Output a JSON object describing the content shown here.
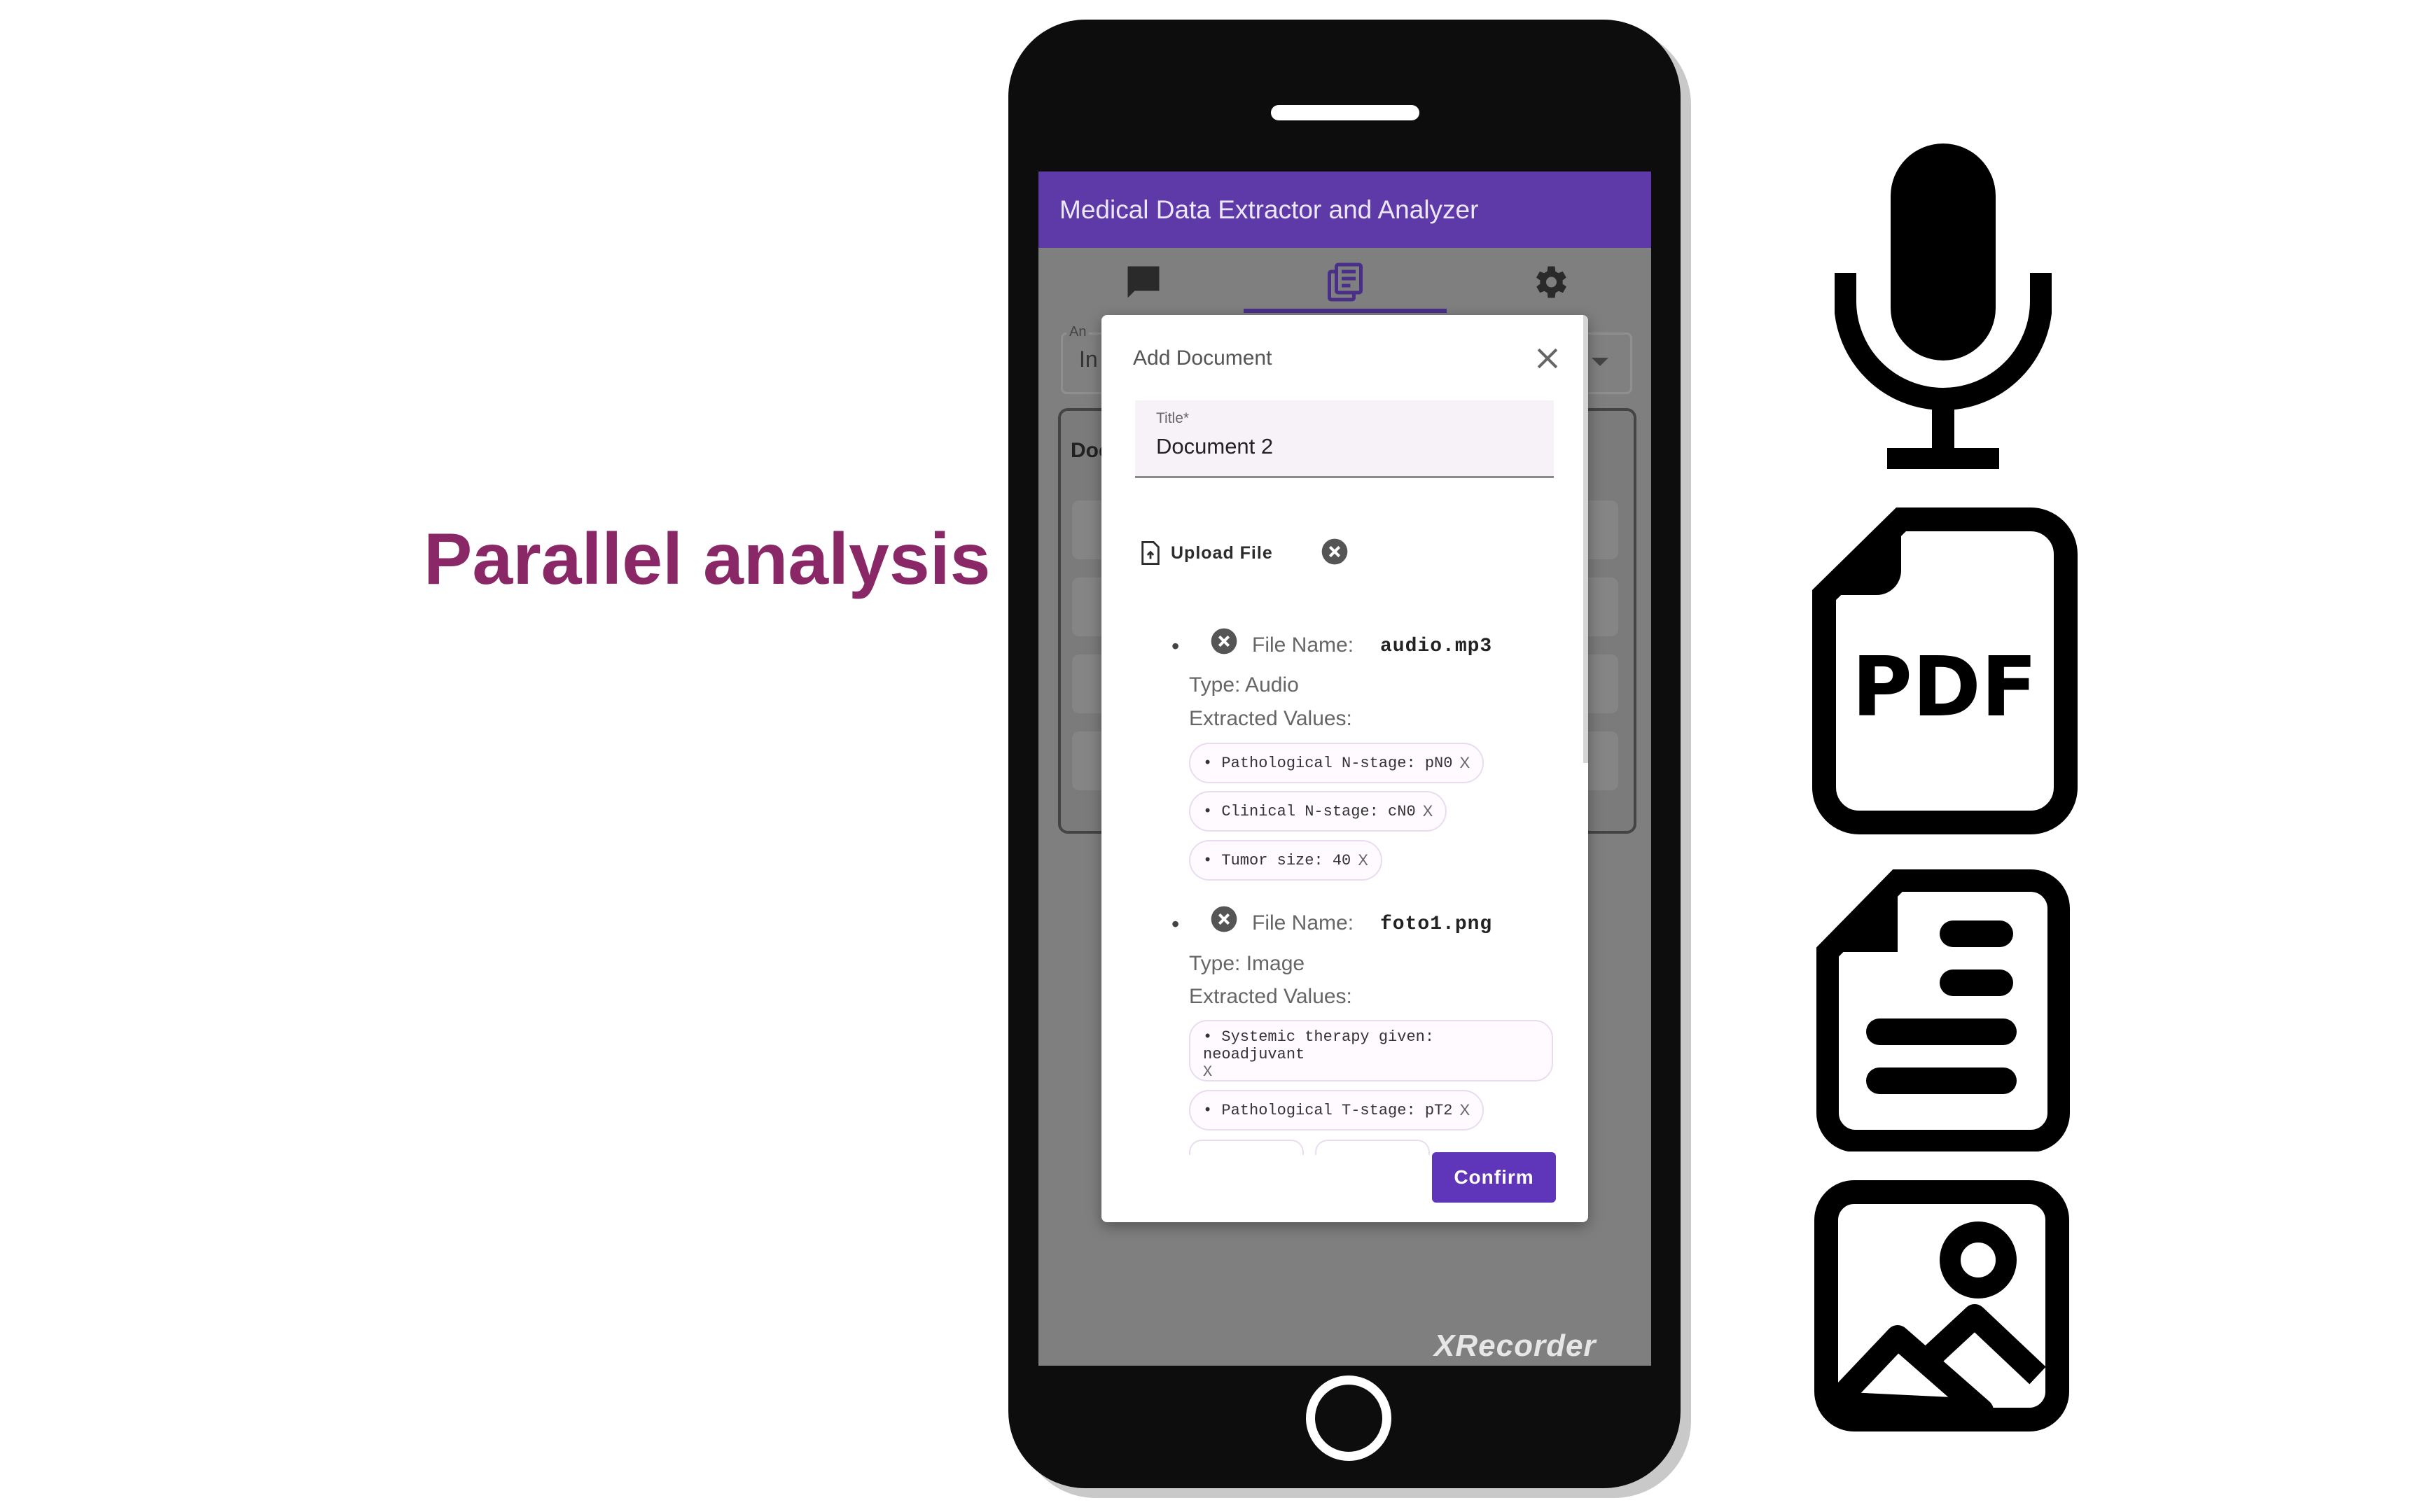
{
  "headline": "Parallel analysis",
  "app": {
    "title": "Medical Data Extractor and Analyzer",
    "tabs": [
      {
        "icon": "chat-icon"
      },
      {
        "icon": "document-list-icon",
        "selected": true
      },
      {
        "icon": "gear-icon"
      }
    ],
    "background": {
      "select_label": "An",
      "select_value": "In",
      "card_title": "Doc"
    }
  },
  "dialog": {
    "title": "Add Document",
    "title_field": {
      "label": "Title*",
      "value": "Document 2"
    },
    "upload_label": "Upload File",
    "file_name_label": "File Name:",
    "extracted_values_label": "Extracted Values:",
    "files": [
      {
        "name": "audio.mp3",
        "type": "Type: Audio",
        "values": [
          "• Pathological N-stage: pN0",
          "• Clinical N-stage: cN0",
          "• Tumor size: 40"
        ]
      },
      {
        "name": "foto1.png",
        "type": "Type: Image",
        "values": [
          "• Systemic therapy given: neoadjuvant",
          "• Pathological T-stage: pT2"
        ]
      }
    ],
    "chip_remove": "X",
    "confirm_label": "Confirm"
  },
  "watermark": "XRecorder",
  "side_icons": [
    {
      "icon": "microphone-icon"
    },
    {
      "icon": "pdf-file-icon",
      "text": "PDF"
    },
    {
      "icon": "text-document-icon"
    },
    {
      "icon": "image-icon"
    }
  ],
  "colors": {
    "headline": "#8a2766",
    "app_bar": "#5e3aa8",
    "confirm_button": "#5f35b9",
    "phone_body": "#0d0d0d"
  }
}
